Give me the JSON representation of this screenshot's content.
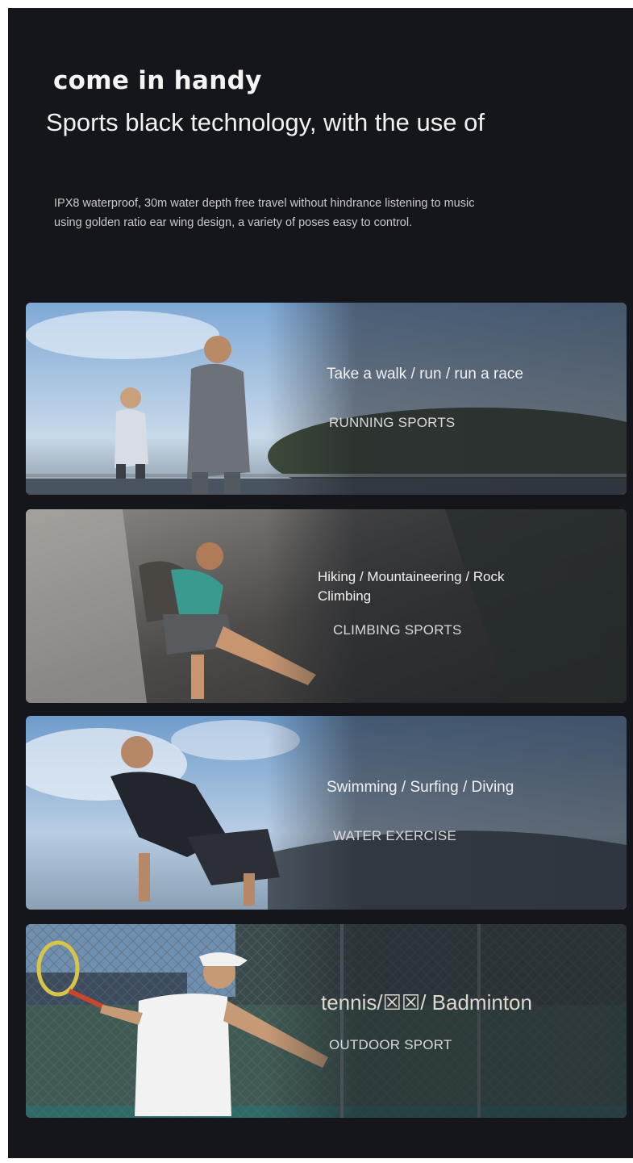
{
  "heading": {
    "title": "come in handy",
    "subtitle": "Sports black technology, with the use of",
    "description": "IPX8 waterproof, 30m water depth free travel without hindrance listening to music using golden ratio ear wing design, a variety of poses easy to control."
  },
  "cards": [
    {
      "caption": "Take a walk / run / run a race",
      "tag": "RUNNING SPORTS"
    },
    {
      "caption": "Hiking / Mountaineering / Rock Climbing",
      "tag": "CLIMBING SPORTS"
    },
    {
      "caption": "Swimming / Surfing / Diving",
      "tag": "WATER EXERCISE"
    },
    {
      "caption": "tennis/☒☒/ Badminton",
      "tag": "OUTDOOR SPORT"
    }
  ]
}
